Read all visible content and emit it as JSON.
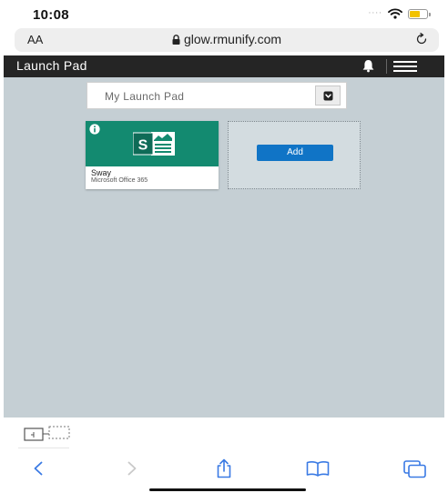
{
  "status_bar": {
    "time": "10:08"
  },
  "browser": {
    "text_size_label": "AA",
    "url": "glow.rmunify.com"
  },
  "app_header": {
    "title": "Launch Pad"
  },
  "launch_pad": {
    "selector_label": "My Launch Pad",
    "tiles": [
      {
        "name": "Sway",
        "subtitle": "Microsoft Office 365",
        "color": "#138a70"
      }
    ],
    "add_label": "Add"
  },
  "icons": {
    "toolbar": [
      "back-icon",
      "forward-icon",
      "share-icon",
      "bookmarks-icon",
      "tabs-icon"
    ],
    "header": [
      "bell-icon",
      "menu-icon"
    ]
  },
  "colors": {
    "header_bg": "#252525",
    "content_bg": "#c5cfd4",
    "add_button": "#1074c6",
    "ios_blue": "#3a7ae4"
  }
}
